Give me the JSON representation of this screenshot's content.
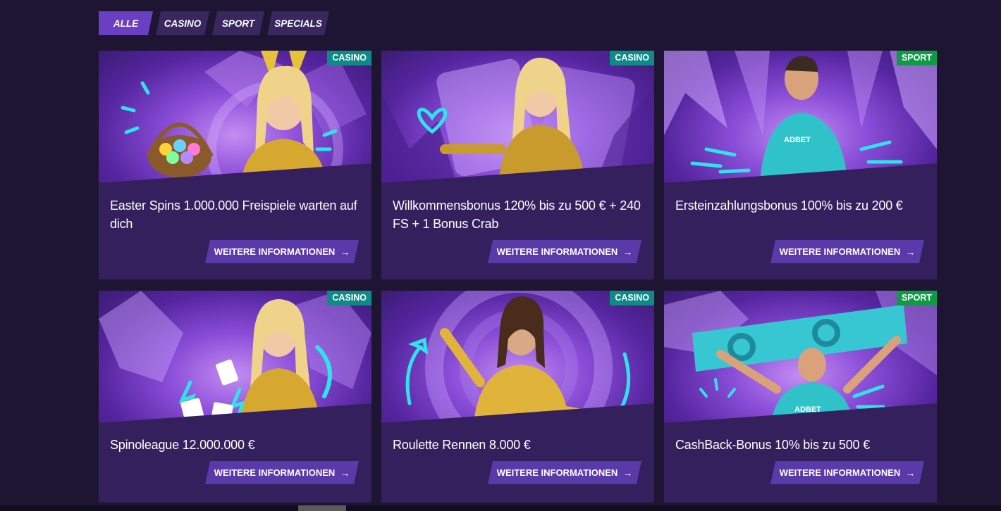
{
  "tabs": [
    "ALLE",
    "CASINO",
    "SPORT",
    "SPECIALS"
  ],
  "active_tab": "ALLE",
  "colors": {
    "background": "#1e1533",
    "card": "#33205c",
    "active_tab": "#6a3fc2",
    "casino_badge": "#0f8a86",
    "sport_badge": "#0f9a45"
  },
  "cards": [
    {
      "badge": "CASINO",
      "title": "Easter Spins 1.000.000 Freispiele warten auf dich",
      "button": "WEITERE INFORMATIONEN",
      "arrow": "→"
    },
    {
      "badge": "CASINO",
      "title": "Willkommensbonus 120% bis zu 500 € + 240 FS + 1 Bonus Crab",
      "button": "WEITERE INFORMATIONEN",
      "arrow": "→"
    },
    {
      "badge": "SPORT",
      "title": "Ersteinzahlungsbonus 100% bis zu 200 €",
      "button": "WEITERE INFORMATIONEN",
      "arrow": "→"
    },
    {
      "badge": "CASINO",
      "title": "Spinoleague 12.000.000 €",
      "button": "WEITERE INFORMATIONEN",
      "arrow": "→"
    },
    {
      "badge": "CASINO",
      "title": "Roulette Rennen 8.000 €",
      "button": "WEITERE INFORMATIONEN",
      "arrow": "→"
    },
    {
      "badge": "SPORT",
      "title": "CashBack-Bonus 10% bis zu 500 €",
      "button": "WEITERE INFORMATIONEN",
      "arrow": "→"
    }
  ]
}
